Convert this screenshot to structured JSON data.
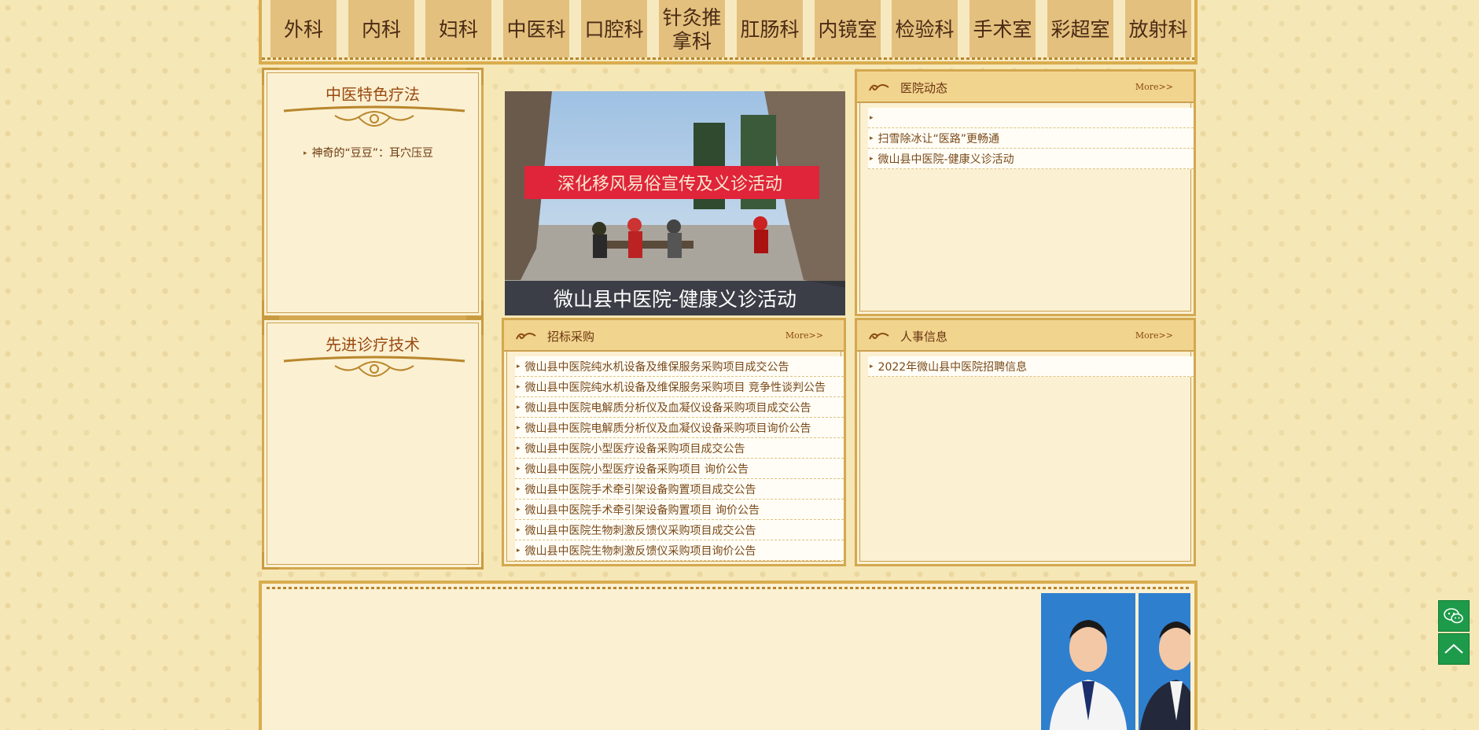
{
  "nav": {
    "items": [
      "外科",
      "内科",
      "妇科",
      "中医科",
      "口腔科",
      "针灸推拿科",
      "肛肠科",
      "内镜室",
      "检验科",
      "手术室",
      "彩超室",
      "放射科"
    ],
    "item5_line1": "针灸推",
    "item5_line2": "拿科"
  },
  "left_panel_top": {
    "title": "中医特色疗法",
    "links": [
      "神奇的“豆豆”：耳穴压豆"
    ]
  },
  "left_panel_bottom": {
    "title": "先进诊疗技术"
  },
  "slide": {
    "banner_text": "深化移风易俗宣传及义诊活动",
    "caption": "微山县中医院-健康义诊活动"
  },
  "hospital_news": {
    "title": "医院动态",
    "more": "More>>",
    "items": [
      "",
      "扫雪除冰让“医路”更畅通",
      "微山县中医院-健康义诊活动"
    ]
  },
  "procurement": {
    "title": "招标采购",
    "more": "More>>",
    "items": [
      "微山县中医院纯水机设备及维保服务采购项目成交公告",
      "微山县中医院纯水机设备及维保服务采购项目 竞争性谈判公告",
      "微山县中医院电解质分析仪及血凝仪设备采购项目成交公告",
      "微山县中医院电解质分析仪及血凝仪设备采购项目询价公告",
      "微山县中医院小型医疗设备采购项目成交公告",
      "微山县中医院小型医疗设备采购项目 询价公告",
      "微山县中医院手术牵引架设备购置项目成交公告",
      "微山县中医院手术牵引架设备购置项目 询价公告",
      "微山县中医院生物刺激反馈仪采购项目成交公告",
      "微山县中医院生物刺激反馈仪采购项目询价公告"
    ]
  },
  "personnel": {
    "title": "人事信息",
    "more": "More>>",
    "items": [
      "2022年微山县中医院招聘信息"
    ]
  },
  "colors": {
    "background": "#f6e7b6",
    "nav_item": "#e3c07e",
    "border_gold": "#d9ad4f",
    "float_green": "#1d9b4a"
  },
  "icons": {
    "wechat": "wechat-icon",
    "back_to_top": "chevron-up-icon",
    "bullet": "bullet-icon",
    "swirl": "swirl-icon"
  }
}
